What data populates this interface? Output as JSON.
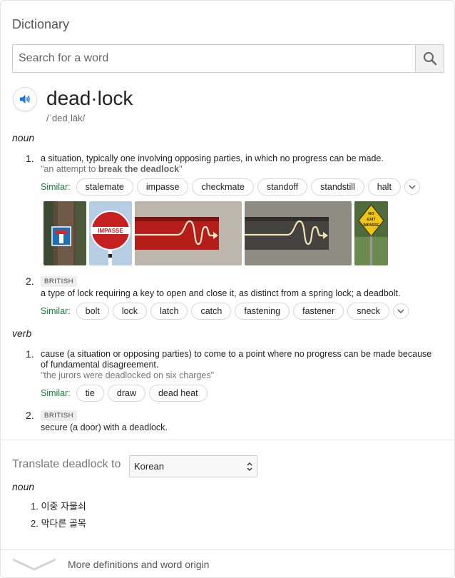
{
  "panel": {
    "title": "Dictionary"
  },
  "search": {
    "placeholder": "Search for a word",
    "icon": "search-icon"
  },
  "entry": {
    "word": "dead·lock",
    "phonetic": "/ˈdedˌläk/",
    "speaker_icon": "speaker-icon"
  },
  "noun": {
    "label": "noun",
    "senses": [
      {
        "num": "1.",
        "definition": "a situation, typically one involving opposing parties, in which no progress can be made.",
        "example_pre": "\"an attempt to ",
        "example_bold": "break the deadlock",
        "example_post": "\"",
        "similar_label": "Similar:",
        "similar": [
          "stalemate",
          "impasse",
          "checkmate",
          "standoff",
          "standstill",
          "halt"
        ]
      },
      {
        "num": "2.",
        "badge": "BRITISH",
        "definition": "a type of lock requiring a key to open and close it, as distinct from a spring lock; a deadbolt.",
        "similar_label": "Similar:",
        "similar": [
          "bolt",
          "lock",
          "latch",
          "catch",
          "fastening",
          "fastener",
          "sneck"
        ]
      }
    ],
    "images": [
      {
        "alt": "dead end sign on tree"
      },
      {
        "alt": "IMPASSE",
        "sign_text": "IMPASSE"
      },
      {
        "alt": "tangled arrow red"
      },
      {
        "alt": "tangled arrow grey"
      },
      {
        "alt": "no exit impasse sign",
        "sign_lines": [
          "NO",
          "EXIT",
          "IMPASSE"
        ]
      }
    ]
  },
  "verb": {
    "label": "verb",
    "senses": [
      {
        "num": "1.",
        "definition": "cause (a situation or opposing parties) to come to a point where no progress can be made because of fundamental disagreement.",
        "example": "\"the jurors were deadlocked on six charges\"",
        "similar_label": "Similar:",
        "similar": [
          "tie",
          "draw",
          "dead heat"
        ]
      },
      {
        "num": "2.",
        "badge": "BRITISH",
        "definition": "secure (a door) with a deadlock."
      }
    ]
  },
  "translate": {
    "label": "Translate deadlock to",
    "language": "Korean",
    "pos": "noun",
    "items": [
      {
        "num": "1.",
        "text": "이중 자물쇠"
      },
      {
        "num": "2.",
        "text": "막다른 골목"
      }
    ]
  },
  "footer": {
    "more_label": "More definitions and word origin",
    "icon": "chevron-down-icon"
  }
}
